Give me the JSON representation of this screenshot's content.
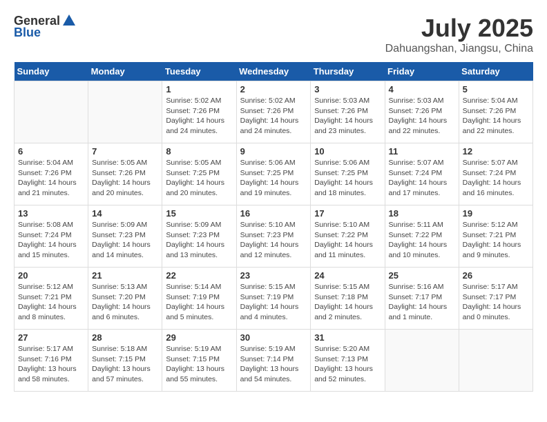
{
  "header": {
    "logo_general": "General",
    "logo_blue": "Blue",
    "month": "July 2025",
    "location": "Dahuangshan, Jiangsu, China"
  },
  "days_of_week": [
    "Sunday",
    "Monday",
    "Tuesday",
    "Wednesday",
    "Thursday",
    "Friday",
    "Saturday"
  ],
  "weeks": [
    [
      {
        "day": "",
        "sunrise": "",
        "sunset": "",
        "daylight": ""
      },
      {
        "day": "",
        "sunrise": "",
        "sunset": "",
        "daylight": ""
      },
      {
        "day": "1",
        "sunrise": "Sunrise: 5:02 AM",
        "sunset": "Sunset: 7:26 PM",
        "daylight": "Daylight: 14 hours and 24 minutes."
      },
      {
        "day": "2",
        "sunrise": "Sunrise: 5:02 AM",
        "sunset": "Sunset: 7:26 PM",
        "daylight": "Daylight: 14 hours and 24 minutes."
      },
      {
        "day": "3",
        "sunrise": "Sunrise: 5:03 AM",
        "sunset": "Sunset: 7:26 PM",
        "daylight": "Daylight: 14 hours and 23 minutes."
      },
      {
        "day": "4",
        "sunrise": "Sunrise: 5:03 AM",
        "sunset": "Sunset: 7:26 PM",
        "daylight": "Daylight: 14 hours and 22 minutes."
      },
      {
        "day": "5",
        "sunrise": "Sunrise: 5:04 AM",
        "sunset": "Sunset: 7:26 PM",
        "daylight": "Daylight: 14 hours and 22 minutes."
      }
    ],
    [
      {
        "day": "6",
        "sunrise": "Sunrise: 5:04 AM",
        "sunset": "Sunset: 7:26 PM",
        "daylight": "Daylight: 14 hours and 21 minutes."
      },
      {
        "day": "7",
        "sunrise": "Sunrise: 5:05 AM",
        "sunset": "Sunset: 7:26 PM",
        "daylight": "Daylight: 14 hours and 20 minutes."
      },
      {
        "day": "8",
        "sunrise": "Sunrise: 5:05 AM",
        "sunset": "Sunset: 7:25 PM",
        "daylight": "Daylight: 14 hours and 20 minutes."
      },
      {
        "day": "9",
        "sunrise": "Sunrise: 5:06 AM",
        "sunset": "Sunset: 7:25 PM",
        "daylight": "Daylight: 14 hours and 19 minutes."
      },
      {
        "day": "10",
        "sunrise": "Sunrise: 5:06 AM",
        "sunset": "Sunset: 7:25 PM",
        "daylight": "Daylight: 14 hours and 18 minutes."
      },
      {
        "day": "11",
        "sunrise": "Sunrise: 5:07 AM",
        "sunset": "Sunset: 7:24 PM",
        "daylight": "Daylight: 14 hours and 17 minutes."
      },
      {
        "day": "12",
        "sunrise": "Sunrise: 5:07 AM",
        "sunset": "Sunset: 7:24 PM",
        "daylight": "Daylight: 14 hours and 16 minutes."
      }
    ],
    [
      {
        "day": "13",
        "sunrise": "Sunrise: 5:08 AM",
        "sunset": "Sunset: 7:24 PM",
        "daylight": "Daylight: 14 hours and 15 minutes."
      },
      {
        "day": "14",
        "sunrise": "Sunrise: 5:09 AM",
        "sunset": "Sunset: 7:23 PM",
        "daylight": "Daylight: 14 hours and 14 minutes."
      },
      {
        "day": "15",
        "sunrise": "Sunrise: 5:09 AM",
        "sunset": "Sunset: 7:23 PM",
        "daylight": "Daylight: 14 hours and 13 minutes."
      },
      {
        "day": "16",
        "sunrise": "Sunrise: 5:10 AM",
        "sunset": "Sunset: 7:23 PM",
        "daylight": "Daylight: 14 hours and 12 minutes."
      },
      {
        "day": "17",
        "sunrise": "Sunrise: 5:10 AM",
        "sunset": "Sunset: 7:22 PM",
        "daylight": "Daylight: 14 hours and 11 minutes."
      },
      {
        "day": "18",
        "sunrise": "Sunrise: 5:11 AM",
        "sunset": "Sunset: 7:22 PM",
        "daylight": "Daylight: 14 hours and 10 minutes."
      },
      {
        "day": "19",
        "sunrise": "Sunrise: 5:12 AM",
        "sunset": "Sunset: 7:21 PM",
        "daylight": "Daylight: 14 hours and 9 minutes."
      }
    ],
    [
      {
        "day": "20",
        "sunrise": "Sunrise: 5:12 AM",
        "sunset": "Sunset: 7:21 PM",
        "daylight": "Daylight: 14 hours and 8 minutes."
      },
      {
        "day": "21",
        "sunrise": "Sunrise: 5:13 AM",
        "sunset": "Sunset: 7:20 PM",
        "daylight": "Daylight: 14 hours and 6 minutes."
      },
      {
        "day": "22",
        "sunrise": "Sunrise: 5:14 AM",
        "sunset": "Sunset: 7:19 PM",
        "daylight": "Daylight: 14 hours and 5 minutes."
      },
      {
        "day": "23",
        "sunrise": "Sunrise: 5:15 AM",
        "sunset": "Sunset: 7:19 PM",
        "daylight": "Daylight: 14 hours and 4 minutes."
      },
      {
        "day": "24",
        "sunrise": "Sunrise: 5:15 AM",
        "sunset": "Sunset: 7:18 PM",
        "daylight": "Daylight: 14 hours and 2 minutes."
      },
      {
        "day": "25",
        "sunrise": "Sunrise: 5:16 AM",
        "sunset": "Sunset: 7:17 PM",
        "daylight": "Daylight: 14 hours and 1 minute."
      },
      {
        "day": "26",
        "sunrise": "Sunrise: 5:17 AM",
        "sunset": "Sunset: 7:17 PM",
        "daylight": "Daylight: 14 hours and 0 minutes."
      }
    ],
    [
      {
        "day": "27",
        "sunrise": "Sunrise: 5:17 AM",
        "sunset": "Sunset: 7:16 PM",
        "daylight": "Daylight: 13 hours and 58 minutes."
      },
      {
        "day": "28",
        "sunrise": "Sunrise: 5:18 AM",
        "sunset": "Sunset: 7:15 PM",
        "daylight": "Daylight: 13 hours and 57 minutes."
      },
      {
        "day": "29",
        "sunrise": "Sunrise: 5:19 AM",
        "sunset": "Sunset: 7:15 PM",
        "daylight": "Daylight: 13 hours and 55 minutes."
      },
      {
        "day": "30",
        "sunrise": "Sunrise: 5:19 AM",
        "sunset": "Sunset: 7:14 PM",
        "daylight": "Daylight: 13 hours and 54 minutes."
      },
      {
        "day": "31",
        "sunrise": "Sunrise: 5:20 AM",
        "sunset": "Sunset: 7:13 PM",
        "daylight": "Daylight: 13 hours and 52 minutes."
      },
      {
        "day": "",
        "sunrise": "",
        "sunset": "",
        "daylight": ""
      },
      {
        "day": "",
        "sunrise": "",
        "sunset": "",
        "daylight": ""
      }
    ]
  ]
}
